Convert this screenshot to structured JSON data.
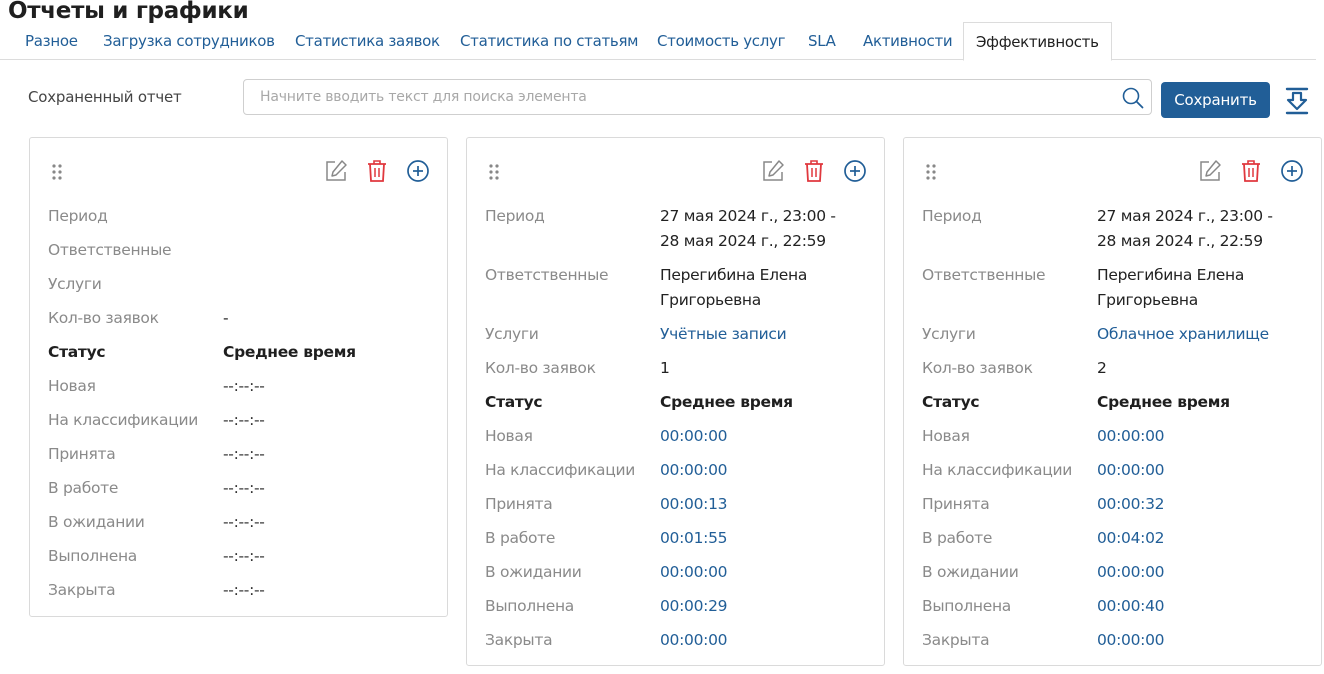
{
  "header": {
    "title": "Отчеты и графики"
  },
  "tabs": [
    {
      "label": "Разное"
    },
    {
      "label": "Загрузка сотрудников"
    },
    {
      "label": "Статистика заявок"
    },
    {
      "label": "Статистика по статьям"
    },
    {
      "label": "Стоимость услуг"
    },
    {
      "label": "SLA"
    },
    {
      "label": "Активности"
    },
    {
      "label": "Эффективность",
      "active": true
    }
  ],
  "toolbar": {
    "saved_report_label": "Сохраненный отчет",
    "search_placeholder": "Начните вводить текст для поиска элемента",
    "search_value": "",
    "save_label": "Сохранить",
    "icons": [
      "search-icon",
      "download-icon"
    ]
  },
  "colors": {
    "accent": "#215e97",
    "danger": "#e0383e",
    "muted_text": "#8a8a8a"
  },
  "labels": {
    "period": "Период",
    "responsible": "Ответственные",
    "services": "Услуги",
    "requests_count": "Кол-во заявок",
    "status_header": "Статус",
    "avg_time_header": "Среднее время"
  },
  "cards": [
    {
      "period_lines": [
        "",
        ""
      ],
      "responsible_lines": [
        "",
        ""
      ],
      "services": "",
      "requests_count": "-",
      "statuses": [
        {
          "name": "Новая",
          "time": "--:--:--"
        },
        {
          "name": "На классификации",
          "time": "--:--:--"
        },
        {
          "name": "Принята",
          "time": "--:--:--"
        },
        {
          "name": "В работе",
          "time": "--:--:--"
        },
        {
          "name": "В ожидании",
          "time": "--:--:--"
        },
        {
          "name": "Выполнена",
          "time": "--:--:--"
        },
        {
          "name": "Закрыта",
          "time": "--:--:--"
        }
      ]
    },
    {
      "period_lines": [
        "27 мая 2024 г., 23:00 -",
        "28 мая 2024 г., 22:59"
      ],
      "responsible_lines": [
        "Перегибина Елена",
        "Григорьевна"
      ],
      "services": "Учётные записи",
      "requests_count": "1",
      "statuses": [
        {
          "name": "Новая",
          "time": "00:00:00"
        },
        {
          "name": "На классификации",
          "time": "00:00:00"
        },
        {
          "name": "Принята",
          "time": "00:00:13"
        },
        {
          "name": "В работе",
          "time": "00:01:55"
        },
        {
          "name": "В ожидании",
          "time": "00:00:00"
        },
        {
          "name": "Выполнена",
          "time": "00:00:29"
        },
        {
          "name": "Закрыта",
          "time": "00:00:00"
        }
      ]
    },
    {
      "period_lines": [
        "27 мая 2024 г., 23:00 -",
        "28 мая 2024 г., 22:59"
      ],
      "responsible_lines": [
        "Перегибина Елена",
        "Григорьевна"
      ],
      "services": "Облачное хранилище",
      "requests_count": "2",
      "statuses": [
        {
          "name": "Новая",
          "time": "00:00:00"
        },
        {
          "name": "На классификации",
          "time": "00:00:00"
        },
        {
          "name": "Принята",
          "time": "00:00:32"
        },
        {
          "name": "В работе",
          "time": "00:04:02"
        },
        {
          "name": "В ожидании",
          "time": "00:00:00"
        },
        {
          "name": "Выполнена",
          "time": "00:00:40"
        },
        {
          "name": "Закрыта",
          "time": "00:00:00"
        }
      ]
    }
  ]
}
